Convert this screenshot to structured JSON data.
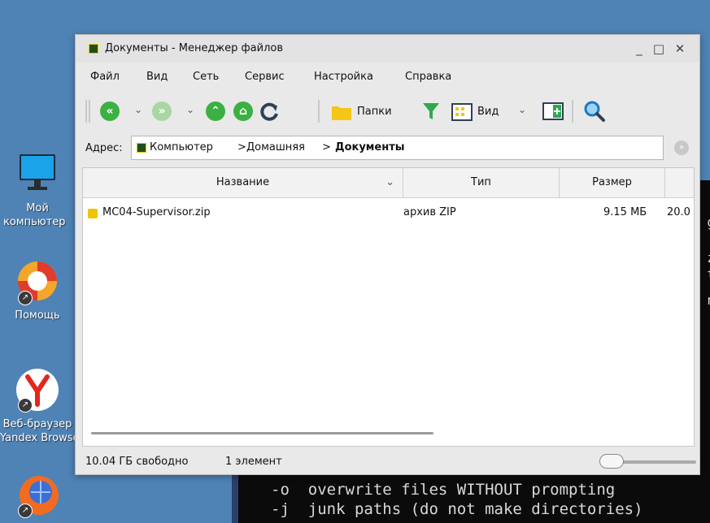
{
  "desktop": {
    "icons": [
      {
        "label_line1": "Мой",
        "label_line2": "компьютер",
        "icon": "monitor-icon"
      },
      {
        "label_line1": "Помощь",
        "icon": "lifebuoy-icon"
      },
      {
        "label_line1": "Веб-браузер",
        "label_line2": "Yandex Browser",
        "icon": "yandex-browser-icon"
      },
      {
        "icon": "firefox-icon"
      }
    ]
  },
  "terminal": {
    "line1": "-o  overwrite files WITHOUT prompting",
    "line2": "-j  junk paths (do not make directories)",
    "edge_chars": [
      "g",
      "z",
      "t",
      "n"
    ]
  },
  "window": {
    "title": "Документы - Менеджер файлов",
    "controls": {
      "minimize": "_",
      "maximize": "□",
      "close": "✕"
    },
    "menu": [
      "Файл",
      "Вид",
      "Сеть",
      "Сервис",
      "Настройка",
      "Справка"
    ],
    "toolbar": {
      "folders_label": "Папки",
      "view_label": "Вид"
    },
    "address": {
      "label": "Адрес:",
      "segments": [
        "Компьютер",
        "Домашняя",
        "Документы"
      ]
    },
    "columns": [
      "Название",
      "Тип",
      "Размер"
    ],
    "files": [
      {
        "name": "MC04-Supervisor.zip",
        "type": "архив ZIP",
        "size": "9.15 МБ",
        "extra": "20.0"
      }
    ],
    "status": {
      "free_space": "10.04 ГБ свободно",
      "count": "1 элемент"
    }
  },
  "colors": {
    "desktop_bg": "#4f83b5",
    "nav_green": "#3cb043",
    "nav_disabled": "#a9d7a3",
    "filter_green": "#2fa84f",
    "folder_yellow": "#f5c518"
  }
}
